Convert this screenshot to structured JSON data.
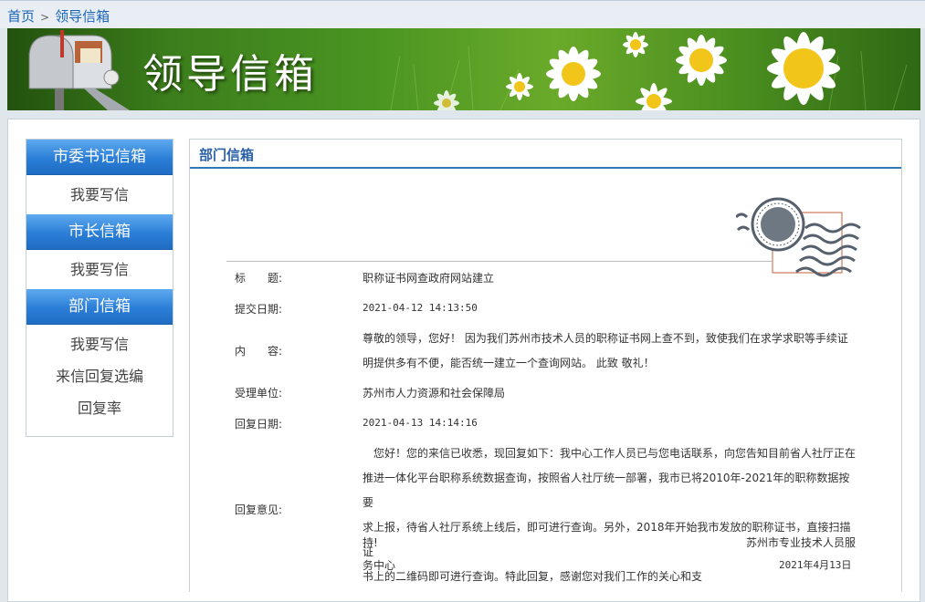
{
  "breadcrumb": {
    "home": "首页",
    "current": "领导信箱"
  },
  "banner": {
    "title": "领导信箱"
  },
  "sidebar": {
    "sections": [
      {
        "title": "市委书记信箱",
        "links": [
          "我要写信"
        ]
      },
      {
        "title": "市长信箱",
        "links": [
          "我要写信"
        ]
      },
      {
        "title": "部门信箱",
        "links": [
          "我要写信",
          "来信回复选编",
          "回复率"
        ]
      }
    ]
  },
  "panel": {
    "title": "部门信箱"
  },
  "letter": {
    "subject_label": "标　　题:",
    "subject": "职称证书网查政府网站建立",
    "submit_date_label": "提交日期:",
    "submit_date": "2021-04-12 14:13:50",
    "content_label": "内　　容:",
    "content_line1": "尊敬的领导，您好！ 因为我们苏州市技术人员的职称证书网上查不到，致使我们在求学求职等手续证",
    "content_line2": "明提供多有不便，能否统一建立一个查询网站。 此致 敬礼！",
    "unit_label": "受理单位:",
    "unit": "苏州市人力资源和社会保障局",
    "reply_date_label": "回复日期:",
    "reply_date": "2021-04-13 14:14:16",
    "reply_label": "回复意见:",
    "reply_line1": "　您好！您的来信已收悉，现回复如下：我中心工作人员已与您电话联系，向您告知目前省人社厅正在",
    "reply_line2": "推进一体化平台职称系统数据查询，按照省人社厅统一部署，我市已将2010年-2021年的职称数据按要",
    "reply_line3": "求上报，待省人社厅系统上线后，即可进行查询。另外，2018年开始我市发放的职称证书，直接扫描证",
    "reply_line4": "书上的二维码即可进行查询。特此回复，感谢您对我们工作的关心和支",
    "reply_line5a": "持!",
    "reply_line5b": "苏州市专业技术人员服",
    "reply_line6a": "务中心",
    "reply_line6b": "2021年4月13日"
  }
}
